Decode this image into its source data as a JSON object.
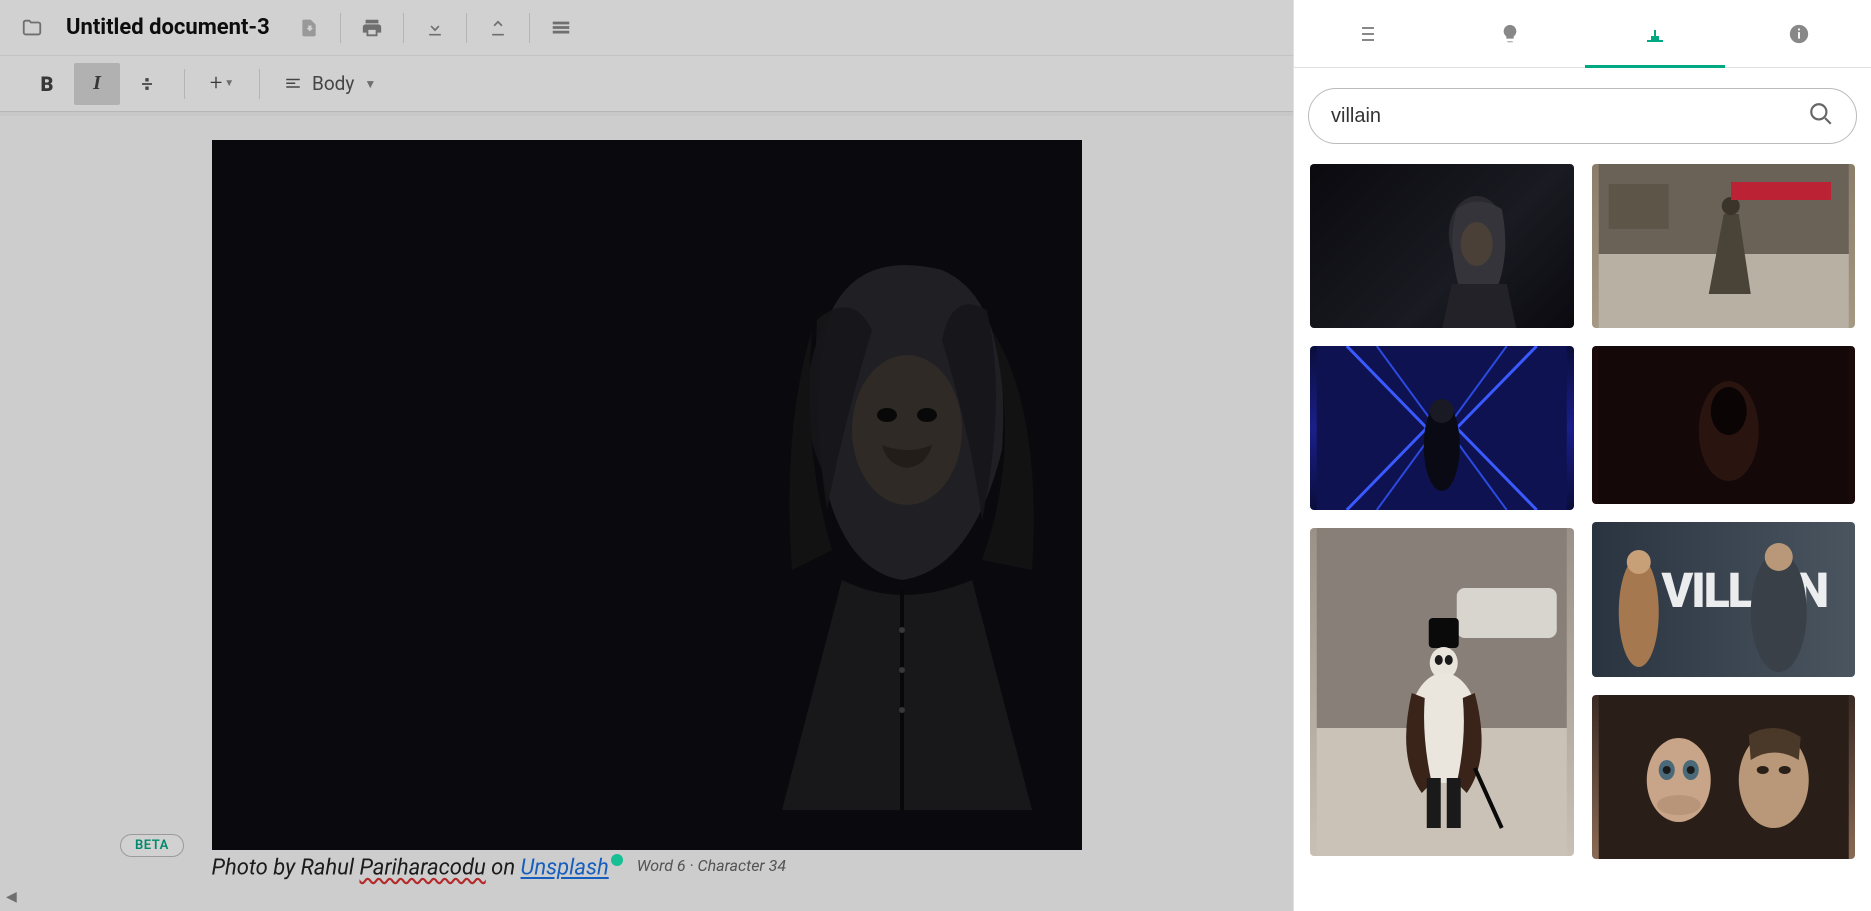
{
  "header": {
    "title": "Untitled document-3"
  },
  "format": {
    "style_label": "Body"
  },
  "editor": {
    "caption_prefix": "Photo by Rahul ",
    "caption_author_wavy": "Pariharacodu",
    "caption_on": " on ",
    "caption_source": "Unsplash",
    "status": "Word 6 · Character 34",
    "beta_label": "BETA"
  },
  "sidebar": {
    "search_value": "villain",
    "results": [
      {
        "name": "result-dark-portrait"
      },
      {
        "name": "result-street-cloak"
      },
      {
        "name": "result-blue-corridor"
      },
      {
        "name": "result-dark-hooded"
      },
      {
        "name": "result-penguin-street"
      },
      {
        "name": "result-villain-text"
      },
      {
        "name": "result-couple-fear"
      }
    ]
  }
}
